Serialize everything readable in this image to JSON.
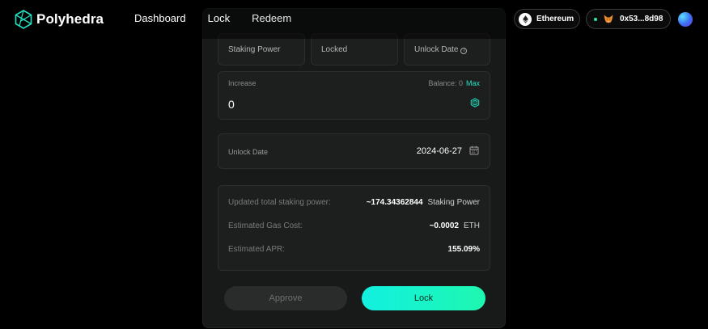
{
  "header": {
    "brand": "Polyhedra",
    "nav": [
      "Dashboard",
      "Lock",
      "Redeem"
    ],
    "chain": "Ethereum",
    "wallet_address": "0x53...8d98",
    "icons": {
      "logo": "polyhedra-logo-icon",
      "chain": "ethereum-icon",
      "wallet": "metamask-fox-icon"
    }
  },
  "stats": {
    "staking_power_label": "Staking Power",
    "locked_label": "Locked",
    "unlock_date_label": "Unlock Date"
  },
  "increase": {
    "label": "Increase",
    "balance_text": "Balance: 0",
    "max_label": "Max",
    "value": "0"
  },
  "unlock": {
    "label": "Unlock Date",
    "value": "2024-06-27"
  },
  "summary": {
    "staking_label": "Updated total staking power:",
    "staking_value": "~174.34362844",
    "staking_unit": "Staking Power",
    "gas_label": "Estimated Gas Cost:",
    "gas_value": "~0.0002",
    "gas_unit": "ETH",
    "apr_label": "Estimated APR:",
    "apr_value": "155.09%"
  },
  "actions": {
    "approve_label": "Approve",
    "lock_label": "Lock"
  },
  "colors": {
    "accent": "#22e3c4",
    "background": "#000000",
    "panel": "#181a19"
  }
}
